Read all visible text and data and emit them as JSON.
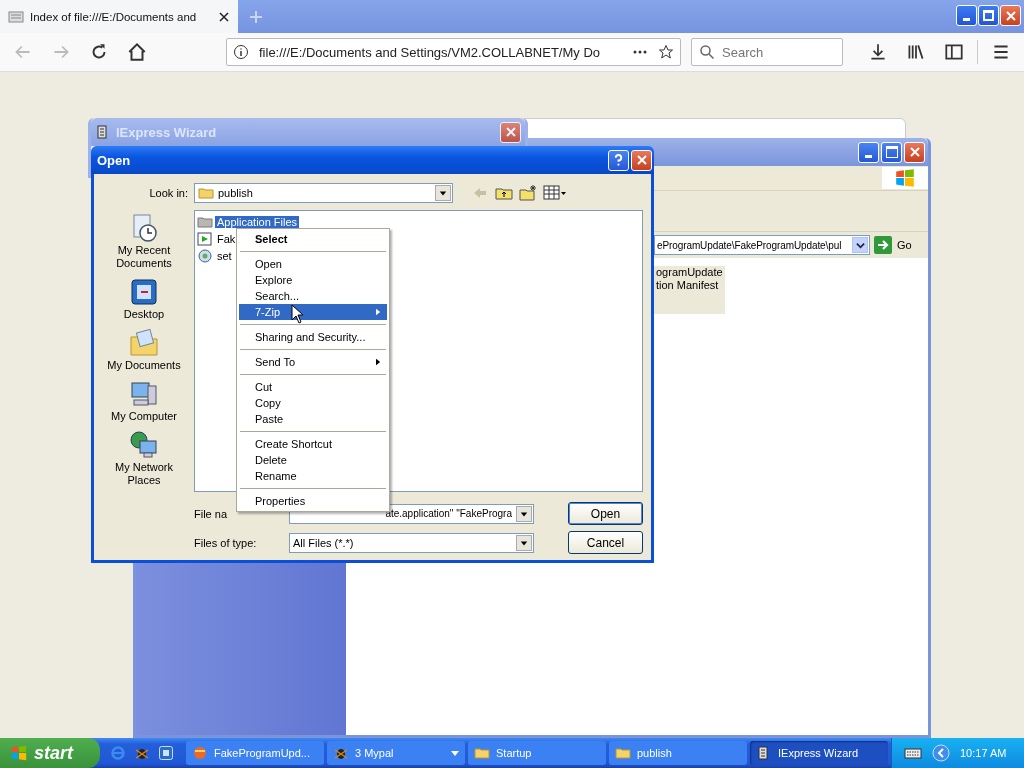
{
  "browser": {
    "tab": {
      "title": "Index of file:///E:/Documents and"
    },
    "url": "file:///E:/Documents and Settings/VM2.COLLABNET/My Do",
    "search": {
      "placeholder": "Search"
    }
  },
  "explorer": {
    "address": "eProgramUpdate\\FakeProgramUpdate\\pul",
    "go_label": "Go",
    "items": [
      "ogramUpdate",
      "tion Manifest"
    ]
  },
  "iexpress": {
    "title": "IExpress Wizard"
  },
  "open_dialog": {
    "title": "Open",
    "look_in_label": "Look in:",
    "look_in_value": "publish",
    "places": [
      {
        "label": "My Recent Documents",
        "kind": "recent"
      },
      {
        "label": "Desktop",
        "kind": "desktop"
      },
      {
        "label": "My Documents",
        "kind": "documents"
      },
      {
        "label": "My Computer",
        "kind": "computer"
      },
      {
        "label": "My Network Places",
        "kind": "network"
      }
    ],
    "files": [
      {
        "name": "Application Files",
        "kind": "folder",
        "selected": true
      },
      {
        "name": "Fak",
        "kind": "app",
        "selected": false
      },
      {
        "name": "set",
        "kind": "setup",
        "selected": false
      }
    ],
    "file_name_label": "File na",
    "file_name_value": "ate.application\" \"FakeProgra",
    "file_type_label": "Files of type:",
    "file_type_value": "All Files (*.*)",
    "buttons": [
      "Open",
      "Cancel"
    ]
  },
  "context_menu": {
    "groups": [
      [
        {
          "label": "Select",
          "default": true,
          "selected": false,
          "submenu": false
        }
      ],
      [
        {
          "label": "Open",
          "default": false,
          "selected": false,
          "submenu": false
        },
        {
          "label": "Explore",
          "default": false,
          "selected": false,
          "submenu": false
        },
        {
          "label": "Search...",
          "default": false,
          "selected": false,
          "submenu": false
        },
        {
          "label": "7-Zip",
          "default": false,
          "selected": true,
          "submenu": true
        }
      ],
      [
        {
          "label": "Sharing and Security...",
          "default": false,
          "selected": false,
          "submenu": false
        }
      ],
      [
        {
          "label": "Send To",
          "default": false,
          "selected": false,
          "submenu": true
        }
      ],
      [
        {
          "label": "Cut",
          "default": false,
          "selected": false,
          "submenu": false
        },
        {
          "label": "Copy",
          "default": false,
          "selected": false,
          "submenu": false
        },
        {
          "label": "Paste",
          "default": false,
          "selected": false,
          "submenu": false
        }
      ],
      [
        {
          "label": "Create Shortcut",
          "default": false,
          "selected": false,
          "submenu": false
        },
        {
          "label": "Delete",
          "default": false,
          "selected": false,
          "submenu": false
        },
        {
          "label": "Rename",
          "default": false,
          "selected": false,
          "submenu": false
        }
      ],
      [
        {
          "label": "Properties",
          "default": false,
          "selected": false,
          "submenu": false
        }
      ]
    ]
  },
  "taskbar": {
    "start": "start",
    "tasks": [
      {
        "label": "FakeProgramUpd...",
        "kind": "mypal",
        "selected": false,
        "menu": false
      },
      {
        "label": "3 Mypal",
        "kind": "bug",
        "selected": false,
        "menu": true
      },
      {
        "label": "Startup",
        "kind": "folder",
        "selected": false,
        "menu": false
      },
      {
        "label": "publish",
        "kind": "folder",
        "selected": false,
        "menu": false
      },
      {
        "label": "IExpress Wizard",
        "kind": "installer",
        "selected": true,
        "menu": false
      }
    ],
    "clock": "10:17 AM"
  }
}
